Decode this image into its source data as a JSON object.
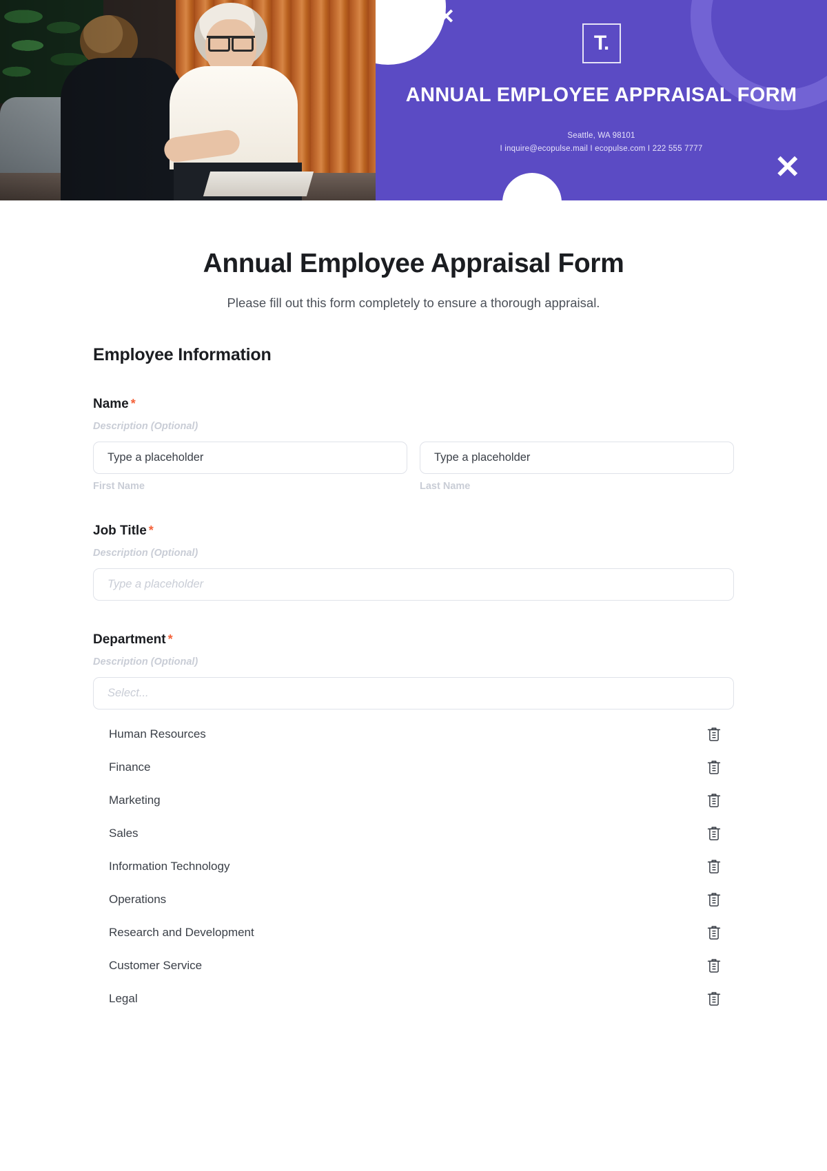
{
  "banner": {
    "logo_text": "T.",
    "title": "ANNUAL EMPLOYEE APPRAISAL FORM",
    "address_line": "Seattle, WA 98101",
    "contact_line": "I inquire@ecopulse.mail I  ecopulse.com I  222 555 7777",
    "close_icon_small": "✕",
    "close_icon_large": "✕",
    "bg_color": "#5B4BC4",
    "ring_color": "#7263D4"
  },
  "form": {
    "title": "Annual Employee Appraisal Form",
    "subtitle": "Please fill out this form completely to ensure a thorough appraisal.",
    "section_title": "Employee Information",
    "required_marker": "*",
    "accent_required_color": "#F4623A",
    "fields": {
      "name": {
        "label": "Name",
        "description": "Description (Optional)",
        "first": {
          "placeholder": "Type a placeholder",
          "sub_label": "First Name"
        },
        "last": {
          "placeholder": "Type a placeholder",
          "sub_label": "Last Name"
        }
      },
      "job_title": {
        "label": "Job Title",
        "description": "Description (Optional)",
        "placeholder": "Type a placeholder"
      },
      "department": {
        "label": "Department",
        "description": "Description (Optional)",
        "placeholder": "Select...",
        "options": [
          "Human Resources",
          "Finance",
          "Marketing",
          "Sales",
          "Information Technology",
          "Operations",
          "Research and Development",
          "Customer Service",
          "Legal"
        ]
      }
    }
  }
}
